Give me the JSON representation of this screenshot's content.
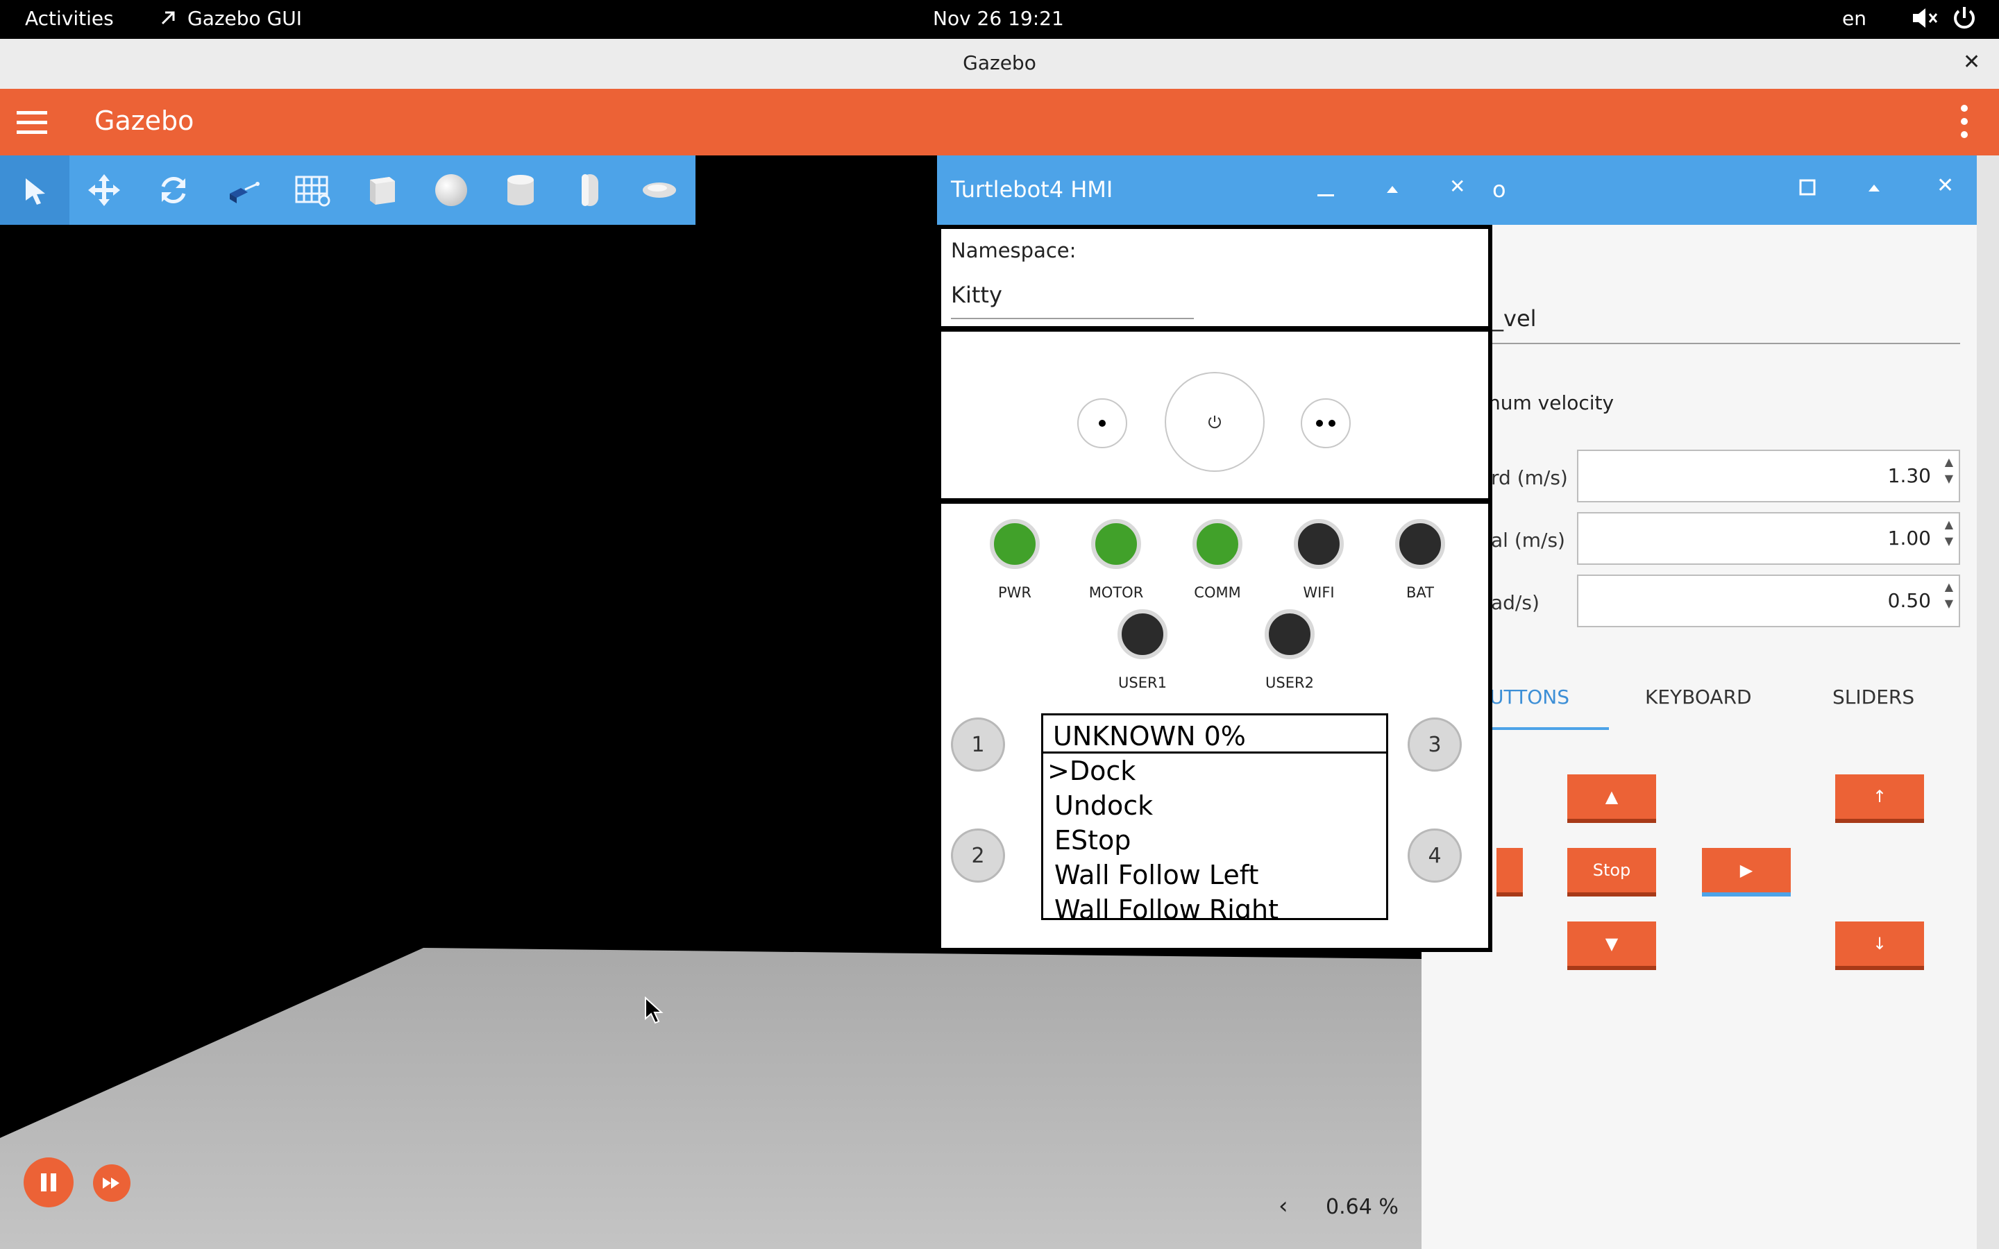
{
  "topbar": {
    "activities": "Activities",
    "app_name": "Gazebo GUI",
    "datetime": "Nov 26  19:21",
    "lang": "en"
  },
  "window": {
    "title": "Gazebo"
  },
  "appbar": {
    "title": "Gazebo"
  },
  "toolbar": {
    "tools": [
      "select-icon",
      "translate-icon",
      "rotate-icon",
      "transform-icon",
      "grid-icon",
      "box-icon",
      "sphere-icon",
      "cylinder-icon",
      "capsule-icon",
      "ellipsoid-icon"
    ]
  },
  "playback": {
    "rtf": "0.64 %",
    "collapse": "‹"
  },
  "hmi": {
    "title": "Turtlebot4 HMI",
    "namespace_label": "Namespace:",
    "namespace_value": "Kitty",
    "leds_row1": [
      {
        "label": "PWR",
        "state": "on"
      },
      {
        "label": "MOTOR",
        "state": "on"
      },
      {
        "label": "COMM",
        "state": "on"
      },
      {
        "label": "WIFI",
        "state": "off"
      },
      {
        "label": "BAT",
        "state": "off"
      }
    ],
    "leds_row2": [
      {
        "label": "USER1",
        "state": "off"
      },
      {
        "label": "USER2",
        "state": "off"
      }
    ],
    "buttons": [
      "1",
      "2",
      "3",
      "4"
    ],
    "display_header": "UNKNOWN 0%",
    "menu": [
      ">Dock",
      "Undock",
      "EStop",
      "Wall Follow Left",
      "Wall Follow Right"
    ],
    "colors": {
      "led_on": "#41a12a",
      "led_off": "#2b2b2b"
    }
  },
  "teleop": {
    "topic_partial": "_vel",
    "section_partial": "num velocity",
    "fields": [
      {
        "label_partial": "rd (m/s)",
        "value": "1.30"
      },
      {
        "label_partial": "al (m/s)",
        "value": "1.00"
      },
      {
        "label_partial": "ad/s)",
        "value": "0.50"
      }
    ],
    "tabs": [
      "UTTONS",
      "KEYBOARD",
      "SLIDERS"
    ],
    "stop_label": "Stop",
    "accent": "#ec6236"
  }
}
